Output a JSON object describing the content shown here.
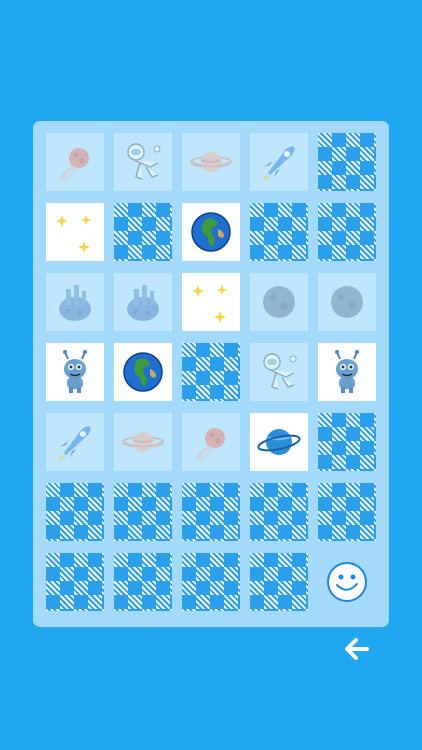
{
  "grid": {
    "columns": 5,
    "rows": 7
  },
  "cards": [
    {
      "state": "matched",
      "icon": "meteor-icon"
    },
    {
      "state": "matched",
      "icon": "astronaut-icon"
    },
    {
      "state": "matched",
      "icon": "saturn-icon"
    },
    {
      "state": "matched",
      "icon": "rocket-icon"
    },
    {
      "state": "down",
      "icon": "card-back-pattern"
    },
    {
      "state": "up",
      "icon": "stars-icon"
    },
    {
      "state": "down",
      "icon": "card-back-pattern"
    },
    {
      "state": "up",
      "icon": "earth-icon"
    },
    {
      "state": "down",
      "icon": "card-back-pattern"
    },
    {
      "state": "down",
      "icon": "card-back-pattern"
    },
    {
      "state": "matched",
      "icon": "asteroid-icon"
    },
    {
      "state": "matched",
      "icon": "asteroid-icon"
    },
    {
      "state": "up",
      "icon": "stars-icon"
    },
    {
      "state": "matched",
      "icon": "moon-icon"
    },
    {
      "state": "matched",
      "icon": "moon-icon"
    },
    {
      "state": "up",
      "icon": "alien-icon"
    },
    {
      "state": "up",
      "icon": "earth-icon"
    },
    {
      "state": "down",
      "icon": "card-back-pattern"
    },
    {
      "state": "matched",
      "icon": "astronaut-icon"
    },
    {
      "state": "up",
      "icon": "alien-icon"
    },
    {
      "state": "matched",
      "icon": "rocket-icon"
    },
    {
      "state": "matched",
      "icon": "saturn-icon"
    },
    {
      "state": "matched",
      "icon": "meteor-icon"
    },
    {
      "state": "up",
      "icon": "planet-ring-icon"
    },
    {
      "state": "down",
      "icon": "card-back-pattern"
    },
    {
      "state": "down",
      "icon": "card-back-pattern"
    },
    {
      "state": "down",
      "icon": "card-back-pattern"
    },
    {
      "state": "down",
      "icon": "card-back-pattern"
    },
    {
      "state": "down",
      "icon": "card-back-pattern"
    },
    {
      "state": "down",
      "icon": "card-back-pattern"
    },
    {
      "state": "down",
      "icon": "card-back-pattern"
    },
    {
      "state": "down",
      "icon": "card-back-pattern"
    },
    {
      "state": "down",
      "icon": "card-back-pattern"
    },
    {
      "state": "down",
      "icon": "card-back-pattern"
    },
    {
      "state": "button",
      "icon": "smiley-icon"
    }
  ],
  "colors": {
    "background": "#21a6f1",
    "board": "#a3d9fb",
    "card_back": "#2b9fe9"
  },
  "back_button": {
    "icon": "back-arrow-icon"
  }
}
